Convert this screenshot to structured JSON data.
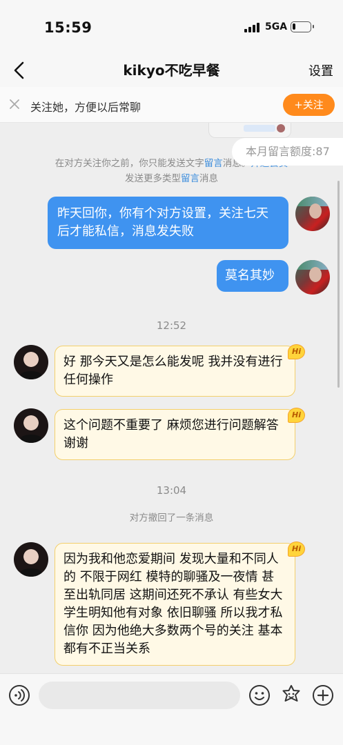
{
  "status_bar": {
    "time": "15:59",
    "network": "5GA",
    "battery_level": 0.15
  },
  "nav": {
    "title": "kikyo不吃早餐",
    "settings_label": "设置"
  },
  "follow_banner": {
    "text": "关注她，方便以后常聊",
    "button_label": "+关注"
  },
  "quota": {
    "text": "本月留言额度:87"
  },
  "system_notice": {
    "line1_prefix": "在对方关注你之前，你只能发送文字",
    "line1_link": "留言",
    "line1_suffix": "消息。",
    "line1_tail": "开通会员",
    "line2_prefix": "发送更多类型",
    "line2_link": "留言",
    "line2_suffix": "消息"
  },
  "messages": [
    {
      "side": "out",
      "text": "昨天回你，你有个对方设置，关注七天后才能私信，消息发失败"
    },
    {
      "side": "out",
      "text": "莫名其妙"
    },
    {
      "side": "in",
      "text": "好 那今天又是怎么能发呢 我并没有进行任何操作"
    },
    {
      "side": "in",
      "text": "这个问题不重要了 麻烦您进行问题解答 谢谢"
    },
    {
      "side": "in",
      "text": "因为我和他恋爱期间 发现大量和不同人的 不限于网红 模特的聊骚及一夜情 甚至出轨同居 这期间还死不承认 有些女大学生明知他有对象 依旧聊骚 所以我才私信你 因为他绝大多数两个号的关注 基本都有不正当关系"
    }
  ],
  "timestamps": [
    "12:52",
    "13:04"
  ],
  "recall_notice": "对方撤回了一条消息",
  "hi_badge": "Hi",
  "input": {
    "placeholder": ""
  },
  "icons": [
    "back-icon",
    "close-icon",
    "voice-icon",
    "emoji-icon",
    "sticker-icon",
    "add-icon"
  ],
  "colors": {
    "accent_orange": "#ff8a1c",
    "bubble_blue": "#3f93f0",
    "bubble_in_bg": "#fff9e6",
    "link_blue": "#3b8cdc"
  }
}
